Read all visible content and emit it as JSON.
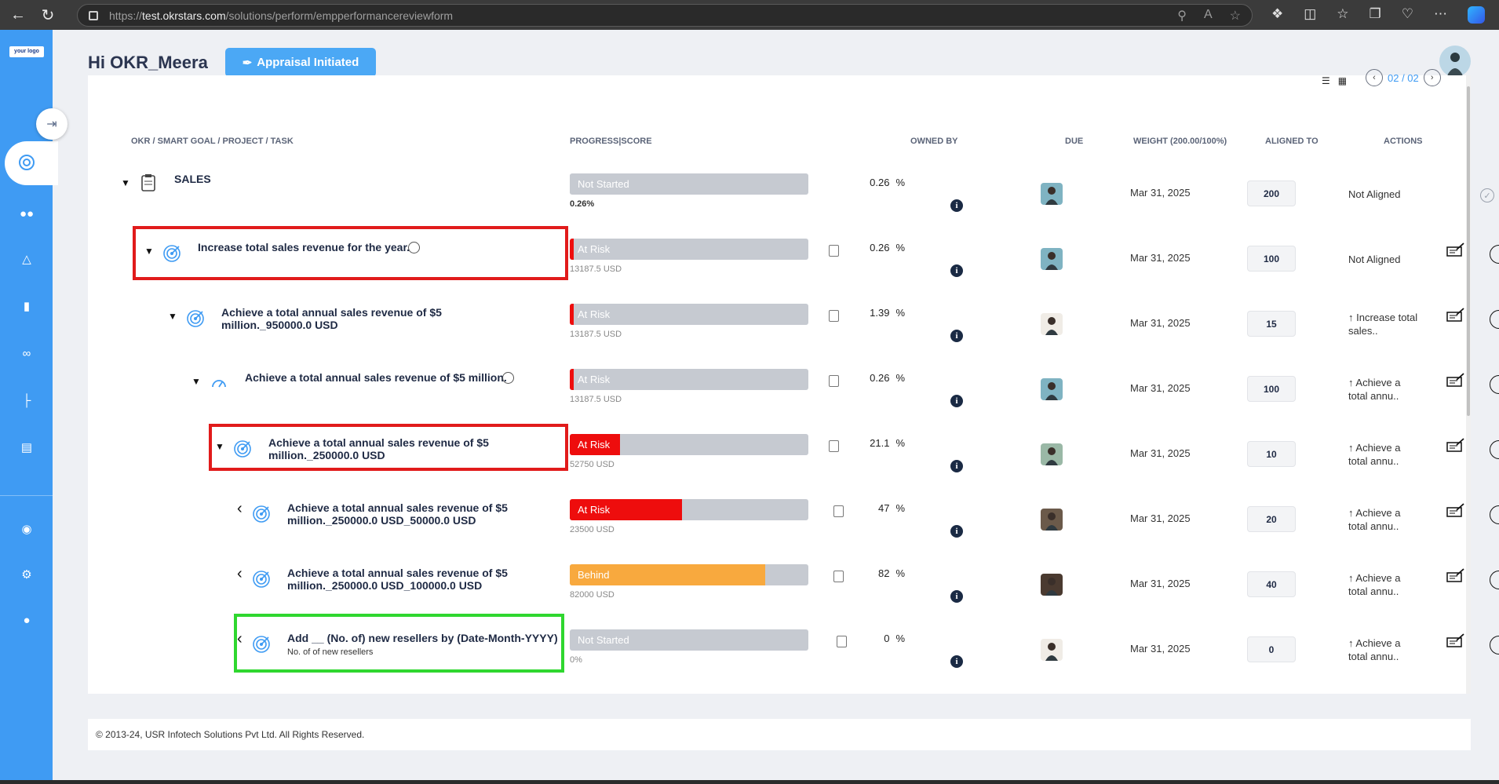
{
  "browser": {
    "url_prefix": "https://",
    "url_domain": "test.okrstars.com",
    "url_path": "/solutions/perform/empperformancereviewform"
  },
  "app": {
    "logo_text": "your logo",
    "greeting": "Hi OKR_Meera",
    "status_button": "Appraisal Initiated",
    "pager": "02 / 02",
    "footer": "© 2013-24, USR Infotech Solutions Pvt Ltd. All Rights Reserved."
  },
  "columns": {
    "goal": "OKR / SMART GOAL / PROJECT / TASK",
    "progress": "PROGRESS|SCORE",
    "owner": "OWNED BY",
    "due": "DUE",
    "weight": "WEIGHT (200.00/100%)",
    "aligned": "ALIGNED TO",
    "actions": "ACTIONS"
  },
  "rows": [
    {
      "title": "SALES",
      "sub": "",
      "caret": "▼",
      "status": "Not Started",
      "progress": 0.26,
      "amount": "0.26%",
      "pct": "0.26",
      "due": "Mar 31, 2025",
      "weight": "200",
      "aligned": "Not Aligned"
    },
    {
      "title": "Increase total sales revenue for the year.",
      "sub": "",
      "caret": "▼",
      "status": "At Risk",
      "progress": 0.26,
      "amount": "13187.5 USD",
      "pct": "0.26",
      "due": "Mar 31, 2025",
      "weight": "100",
      "aligned": "Not Aligned"
    },
    {
      "title": "Achieve a total annual sales revenue of $5 million._950000.0 USD",
      "sub": "",
      "caret": "▼",
      "status": "At Risk",
      "progress": 1.39,
      "amount": "13187.5 USD",
      "pct": "1.39",
      "due": "Mar 31, 2025",
      "weight": "15",
      "aligned": "↑ Increase total sales.."
    },
    {
      "title": "Achieve a total annual sales revenue of $5 million.",
      "sub": "",
      "caret": "▼",
      "status": "At Risk",
      "progress": 0.26,
      "amount": "13187.5 USD",
      "pct": "0.26",
      "due": "Mar 31, 2025",
      "weight": "100",
      "aligned": "↑ Achieve a total annu.."
    },
    {
      "title": "Achieve a total annual sales revenue of $5 million._250000.0 USD",
      "sub": "",
      "caret": "▼",
      "status": "At Risk",
      "progress": 21.1,
      "amount": "52750 USD",
      "pct": "21.1",
      "due": "Mar 31, 2025",
      "weight": "10",
      "aligned": "↑ Achieve a total annu.."
    },
    {
      "title": "Achieve a total annual sales revenue of $5 million._250000.0 USD_50000.0 USD",
      "sub": "",
      "caret": "‹",
      "status": "At Risk",
      "progress": 47,
      "amount": "23500 USD",
      "pct": "47",
      "due": "Mar 31, 2025",
      "weight": "20",
      "aligned": "↑ Achieve a total annu.."
    },
    {
      "title": "Achieve a total annual sales revenue of $5 million._250000.0 USD_100000.0 USD",
      "sub": "",
      "caret": "‹",
      "status": "Behind",
      "progress": 82,
      "amount": "82000 USD",
      "pct": "82",
      "due": "Mar 31, 2025",
      "weight": "40",
      "aligned": "↑ Achieve a total annu.."
    },
    {
      "title": "Add __ (No. of) new resellers by (Date-Month-YYYY)",
      "sub": "No. of of new resellers",
      "caret": "‹",
      "status": "Not Started",
      "progress": 0,
      "amount": "0%",
      "pct": "0",
      "due": "Mar 31, 2025",
      "weight": "0",
      "aligned": "↑ Achieve a total annu.."
    }
  ],
  "colors": {
    "sidebar": "#3f9bf3",
    "at_risk": "#ee0d0d",
    "behind": "#f8a93e",
    "not_started": "#c6cad1",
    "highlight_red": "#e11b1b",
    "highlight_green": "#2fd72f"
  },
  "icons": {
    "percent_sign": "%",
    "info": "i"
  }
}
